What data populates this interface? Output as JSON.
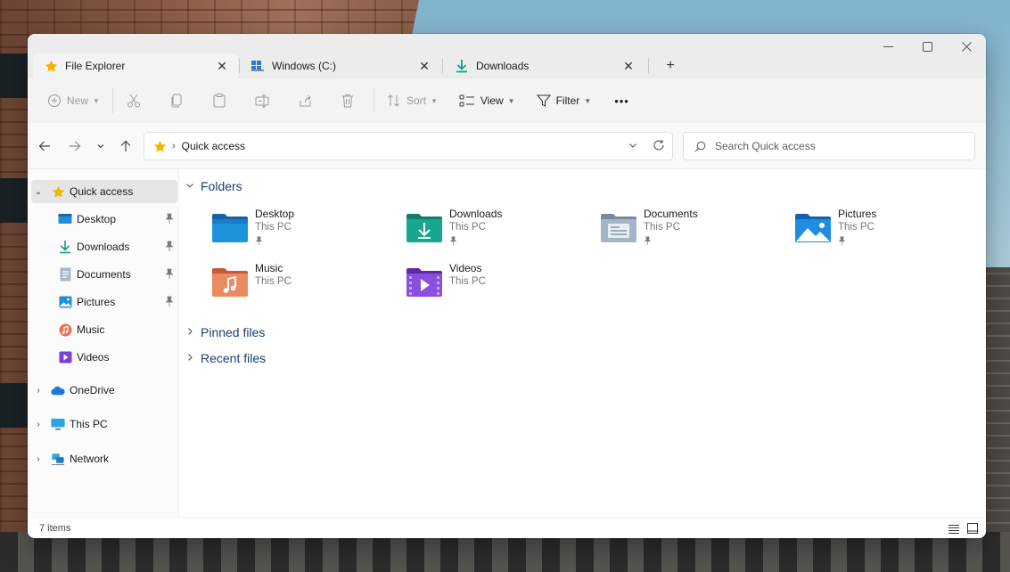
{
  "tabs": [
    {
      "label": "File Explorer",
      "icon": "star-icon",
      "active": true
    },
    {
      "label": "Windows (C:)",
      "icon": "drive-icon",
      "active": false
    },
    {
      "label": "Downloads",
      "icon": "download-icon",
      "active": false
    }
  ],
  "new_tab_glyph": "+",
  "window_controls": [
    "minimize",
    "maximize",
    "close"
  ],
  "toolbar": {
    "new_label": "New",
    "sort_label": "Sort",
    "view_label": "View",
    "filter_label": "Filter",
    "more_glyph": "•••"
  },
  "address": {
    "crumb": "Quick access",
    "separator": "›"
  },
  "search": {
    "placeholder": "Search Quick access"
  },
  "sidebar": {
    "items": [
      {
        "label": "Quick access",
        "icon": "star-icon"
      },
      {
        "label": "Desktop",
        "icon": "desktop-icon"
      },
      {
        "label": "Downloads",
        "icon": "download-icon"
      },
      {
        "label": "Documents",
        "icon": "documents-icon"
      },
      {
        "label": "Pictures",
        "icon": "pictures-icon"
      },
      {
        "label": "Music",
        "icon": "music-icon"
      },
      {
        "label": "Videos",
        "icon": "videos-icon"
      },
      {
        "label": "OneDrive",
        "icon": "cloud-icon"
      },
      {
        "label": "This PC",
        "icon": "monitor-icon"
      },
      {
        "label": "Network",
        "icon": "network-icon"
      }
    ]
  },
  "sections": {
    "folders": "Folders",
    "pinned": "Pinned files",
    "recent": "Recent files"
  },
  "folders": [
    {
      "name": "Desktop",
      "location": "This PC",
      "pinned": true
    },
    {
      "name": "Downloads",
      "location": "This PC",
      "pinned": true
    },
    {
      "name": "Documents",
      "location": "This PC",
      "pinned": true
    },
    {
      "name": "Pictures",
      "location": "This PC",
      "pinned": true
    },
    {
      "name": "Music",
      "location": "This PC",
      "pinned": false
    },
    {
      "name": "Videos",
      "location": "This PC",
      "pinned": false
    }
  ],
  "status": {
    "item_count": "7 items"
  },
  "colors": {
    "accent_star": "#f4b400",
    "section_text": "#1a3f6e"
  }
}
